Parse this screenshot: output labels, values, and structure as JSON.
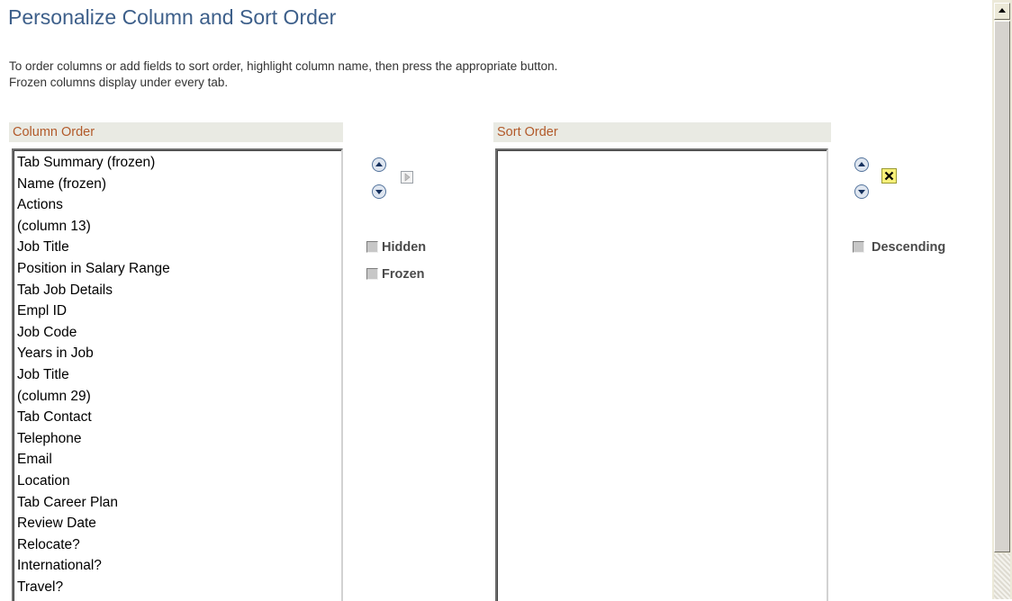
{
  "page": {
    "title": "Personalize Column and Sort Order",
    "instructions": [
      "To order columns or add fields to sort order, highlight column name, then press the appropriate button.",
      "Frozen columns display under every tab."
    ]
  },
  "column_order": {
    "header": "Column Order",
    "items": [
      "Tab Summary (frozen)",
      "Name (frozen)",
      "Actions",
      "(column 13)",
      "Job Title",
      "Position in Salary Range",
      "Tab Job Details",
      "Empl ID",
      "Job Code",
      "Years in Job",
      "Job Title",
      "(column 29)",
      "Tab Contact",
      "Telephone",
      "Email",
      "Location",
      "Tab Career Plan",
      "Review Date",
      "Relocate?",
      "International?",
      "Travel?"
    ]
  },
  "column_controls": {
    "move_up_icon": "up-arrow-icon",
    "move_down_icon": "down-arrow-icon",
    "add_to_sort_icon": "right-arrow-icon",
    "hidden_label": "Hidden",
    "frozen_label": "Frozen",
    "hidden_checked": false,
    "frozen_checked": false
  },
  "sort_order": {
    "header": "Sort Order",
    "items": []
  },
  "sort_controls": {
    "move_up_icon": "up-arrow-icon",
    "move_down_icon": "down-arrow-icon",
    "remove_icon": "close-icon",
    "descending_label": "Descending",
    "descending_checked": false
  },
  "colors": {
    "title": "#3d5f8a",
    "panel_header_text": "#b25a2a",
    "panel_header_bg": "#e9eae3",
    "remove_button_bg": "#f7f07a"
  }
}
